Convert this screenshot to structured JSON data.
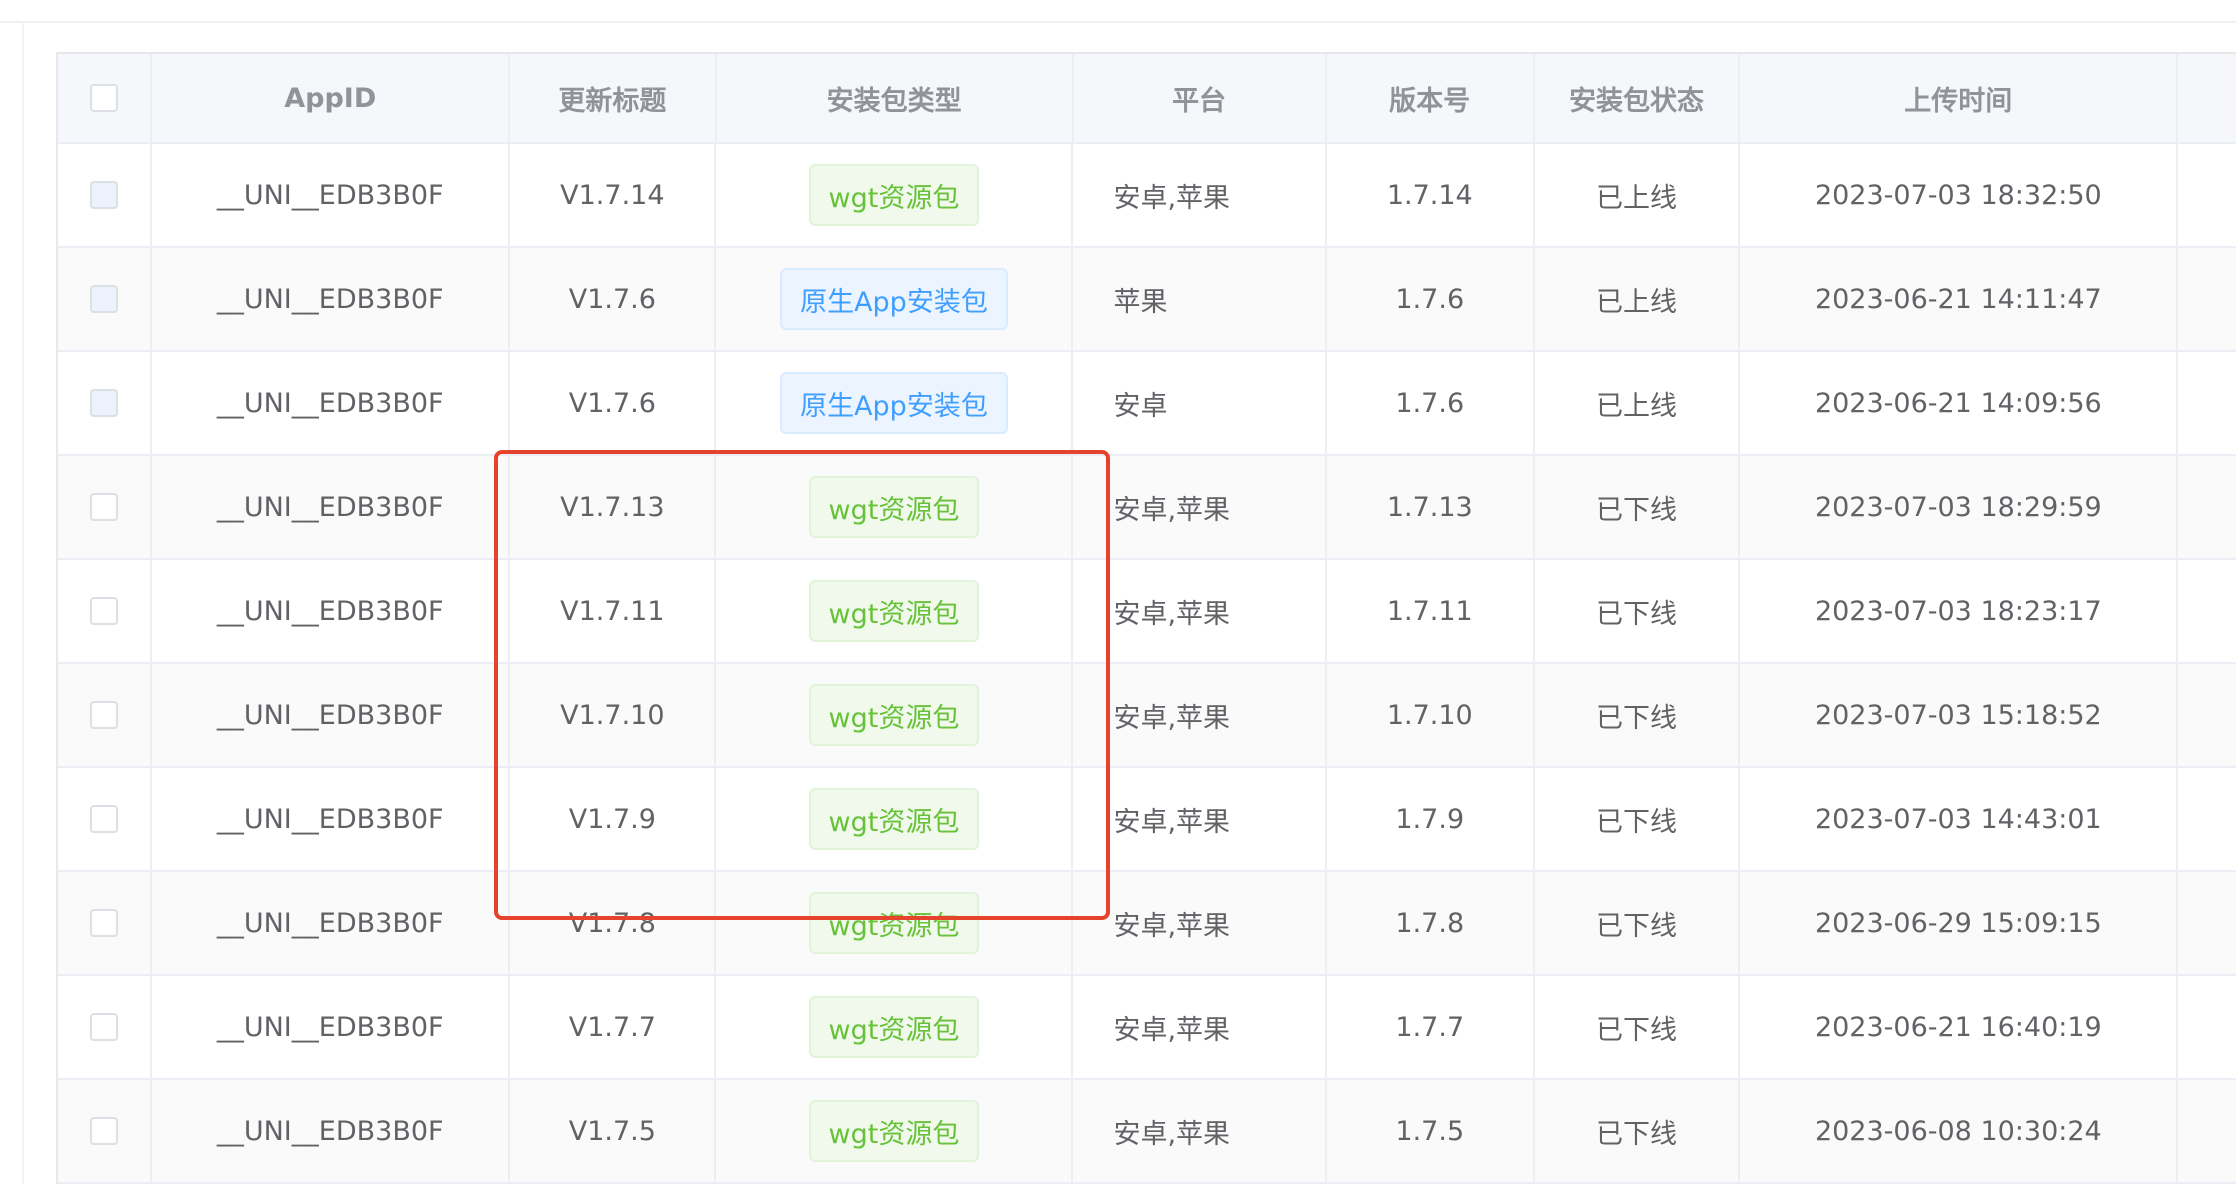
{
  "colors": {
    "tag_green": "#67c23a",
    "tag_blue": "#409eff",
    "highlight": "#e5432c"
  },
  "icons": {
    "checkbox": "checkbox-icon"
  },
  "table": {
    "headers": {
      "appid": "AppID",
      "title": "更新标题",
      "type": "安装包类型",
      "platform": "平台",
      "version": "版本号",
      "status": "安装包状态",
      "time": "上传时间"
    },
    "rows": [
      {
        "appid": "__UNI__EDB3B0F",
        "title": "V1.7.14",
        "type": "wgt资源包",
        "type_color": "green",
        "platform": "安卓,苹果",
        "version": "1.7.14",
        "status": "已上线",
        "time": "2023-07-03 18:32:50",
        "checkbox_shaded": true
      },
      {
        "appid": "__UNI__EDB3B0F",
        "title": "V1.7.6",
        "type": "原生App安装包",
        "type_color": "blue",
        "platform": "苹果",
        "version": "1.7.6",
        "status": "已上线",
        "time": "2023-06-21 14:11:47",
        "checkbox_shaded": true
      },
      {
        "appid": "__UNI__EDB3B0F",
        "title": "V1.7.6",
        "type": "原生App安装包",
        "type_color": "blue",
        "platform": "安卓",
        "version": "1.7.6",
        "status": "已上线",
        "time": "2023-06-21 14:09:56",
        "checkbox_shaded": true
      },
      {
        "appid": "__UNI__EDB3B0F",
        "title": "V1.7.13",
        "type": "wgt资源包",
        "type_color": "green",
        "platform": "安卓,苹果",
        "version": "1.7.13",
        "status": "已下线",
        "time": "2023-07-03 18:29:59",
        "checkbox_shaded": false
      },
      {
        "appid": "__UNI__EDB3B0F",
        "title": "V1.7.11",
        "type": "wgt资源包",
        "type_color": "green",
        "platform": "安卓,苹果",
        "version": "1.7.11",
        "status": "已下线",
        "time": "2023-07-03 18:23:17",
        "checkbox_shaded": false
      },
      {
        "appid": "__UNI__EDB3B0F",
        "title": "V1.7.10",
        "type": "wgt资源包",
        "type_color": "green",
        "platform": "安卓,苹果",
        "version": "1.7.10",
        "status": "已下线",
        "time": "2023-07-03 15:18:52",
        "checkbox_shaded": false
      },
      {
        "appid": "__UNI__EDB3B0F",
        "title": "V1.7.9",
        "type": "wgt资源包",
        "type_color": "green",
        "platform": "安卓,苹果",
        "version": "1.7.9",
        "status": "已下线",
        "time": "2023-07-03 14:43:01",
        "checkbox_shaded": false
      },
      {
        "appid": "__UNI__EDB3B0F",
        "title": "V1.7.8",
        "type": "wgt资源包",
        "type_color": "green",
        "platform": "安卓,苹果",
        "version": "1.7.8",
        "status": "已下线",
        "time": "2023-06-29 15:09:15",
        "checkbox_shaded": false
      },
      {
        "appid": "__UNI__EDB3B0F",
        "title": "V1.7.7",
        "type": "wgt资源包",
        "type_color": "green",
        "platform": "安卓,苹果",
        "version": "1.7.7",
        "status": "已下线",
        "time": "2023-06-21 16:40:19",
        "checkbox_shaded": false
      },
      {
        "appid": "__UNI__EDB3B0F",
        "title": "V1.7.5",
        "type": "wgt资源包",
        "type_color": "green",
        "platform": "安卓,苹果",
        "version": "1.7.5",
        "status": "已下线",
        "time": "2023-06-08 10:30:24",
        "checkbox_shaded": false
      }
    ]
  }
}
